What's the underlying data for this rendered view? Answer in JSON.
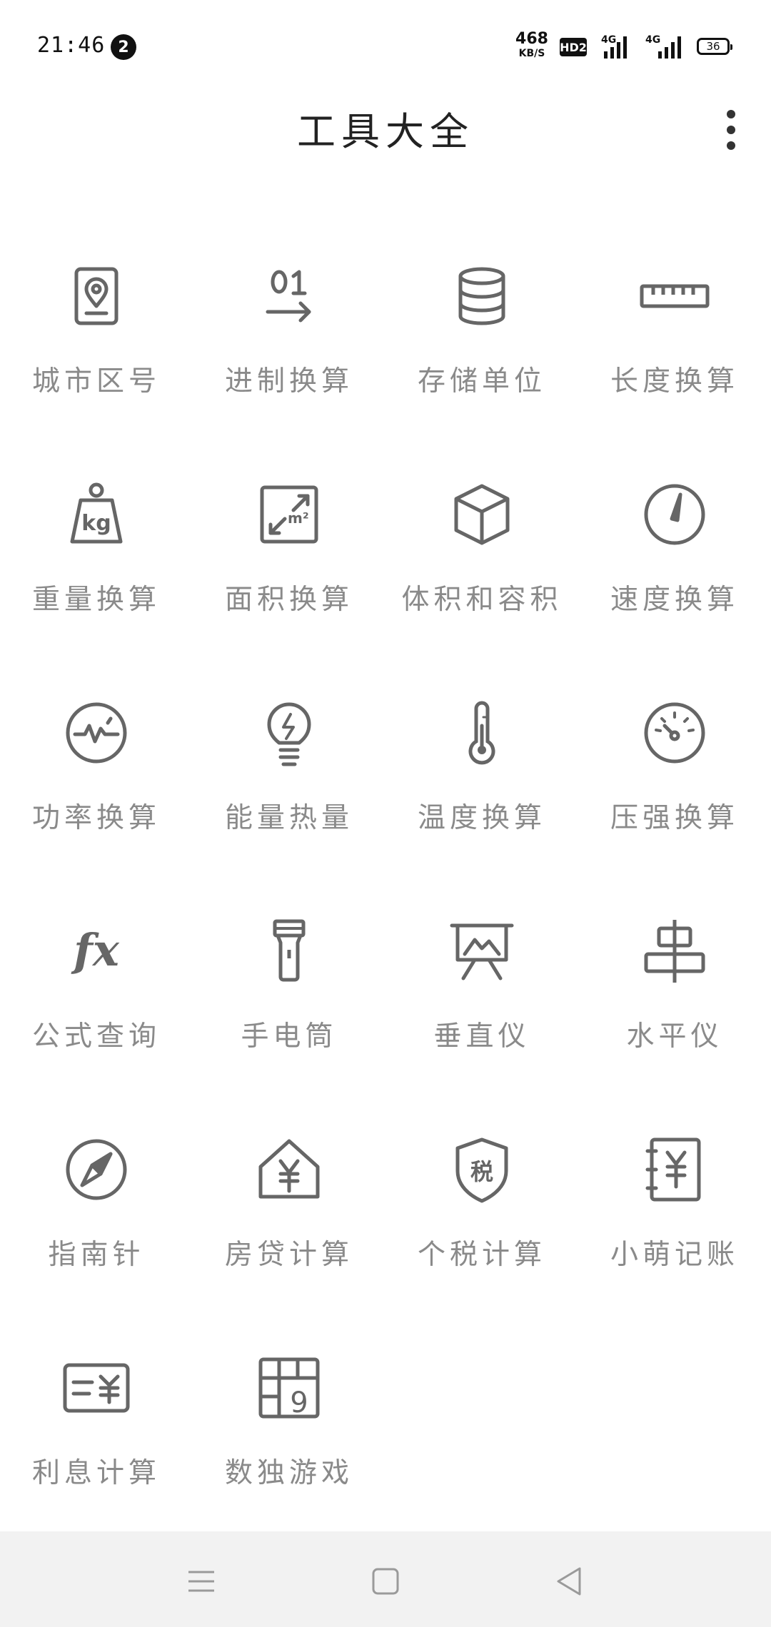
{
  "status_bar": {
    "time": "21:46",
    "notification_count": "2",
    "net_speed_value": "468",
    "net_speed_unit": "KB/S",
    "hd_label": "HD2",
    "signal_1_label": "4G",
    "signal_2_label": "4G",
    "battery_level": "36"
  },
  "header": {
    "title": "工具大全"
  },
  "tools": [
    {
      "label": "城市区号",
      "icon": "map-pin-card-icon"
    },
    {
      "label": "进制换算",
      "icon": "binary-arrow-icon"
    },
    {
      "label": "存储单位",
      "icon": "database-icon"
    },
    {
      "label": "长度换算",
      "icon": "ruler-icon"
    },
    {
      "label": "重量换算",
      "icon": "kg-weight-icon"
    },
    {
      "label": "面积换算",
      "icon": "area-m2-icon"
    },
    {
      "label": "体积和容积",
      "icon": "cube-icon"
    },
    {
      "label": "速度换算",
      "icon": "speedometer-icon"
    },
    {
      "label": "功率换算",
      "icon": "pulse-icon"
    },
    {
      "label": "能量热量",
      "icon": "lightbulb-icon"
    },
    {
      "label": "温度换算",
      "icon": "thermometer-icon"
    },
    {
      "label": "压强换算",
      "icon": "pressure-gauge-icon"
    },
    {
      "label": "公式查询",
      "icon": "fx-icon"
    },
    {
      "label": "手电筒",
      "icon": "flashlight-icon"
    },
    {
      "label": "垂直仪",
      "icon": "easel-icon"
    },
    {
      "label": "水平仪",
      "icon": "align-center-icon"
    },
    {
      "label": "指南针",
      "icon": "compass-icon"
    },
    {
      "label": "房贷计算",
      "icon": "house-yen-icon"
    },
    {
      "label": "个税计算",
      "icon": "tax-shield-icon"
    },
    {
      "label": "小萌记账",
      "icon": "yen-notebook-icon"
    },
    {
      "label": "利息计算",
      "icon": "yen-card-icon"
    },
    {
      "label": "数独游戏",
      "icon": "sudoku-grid-icon"
    }
  ],
  "tax_icon_text": "税",
  "sudoku_icon_digit": "9",
  "nav_bar": {
    "menu": "menu-icon",
    "home": "home-square-icon",
    "back": "back-triangle-icon"
  },
  "colors": {
    "icon": "#666666",
    "label": "#8a8a8a",
    "title": "#222222",
    "nav_bg": "#f2f2f2"
  }
}
